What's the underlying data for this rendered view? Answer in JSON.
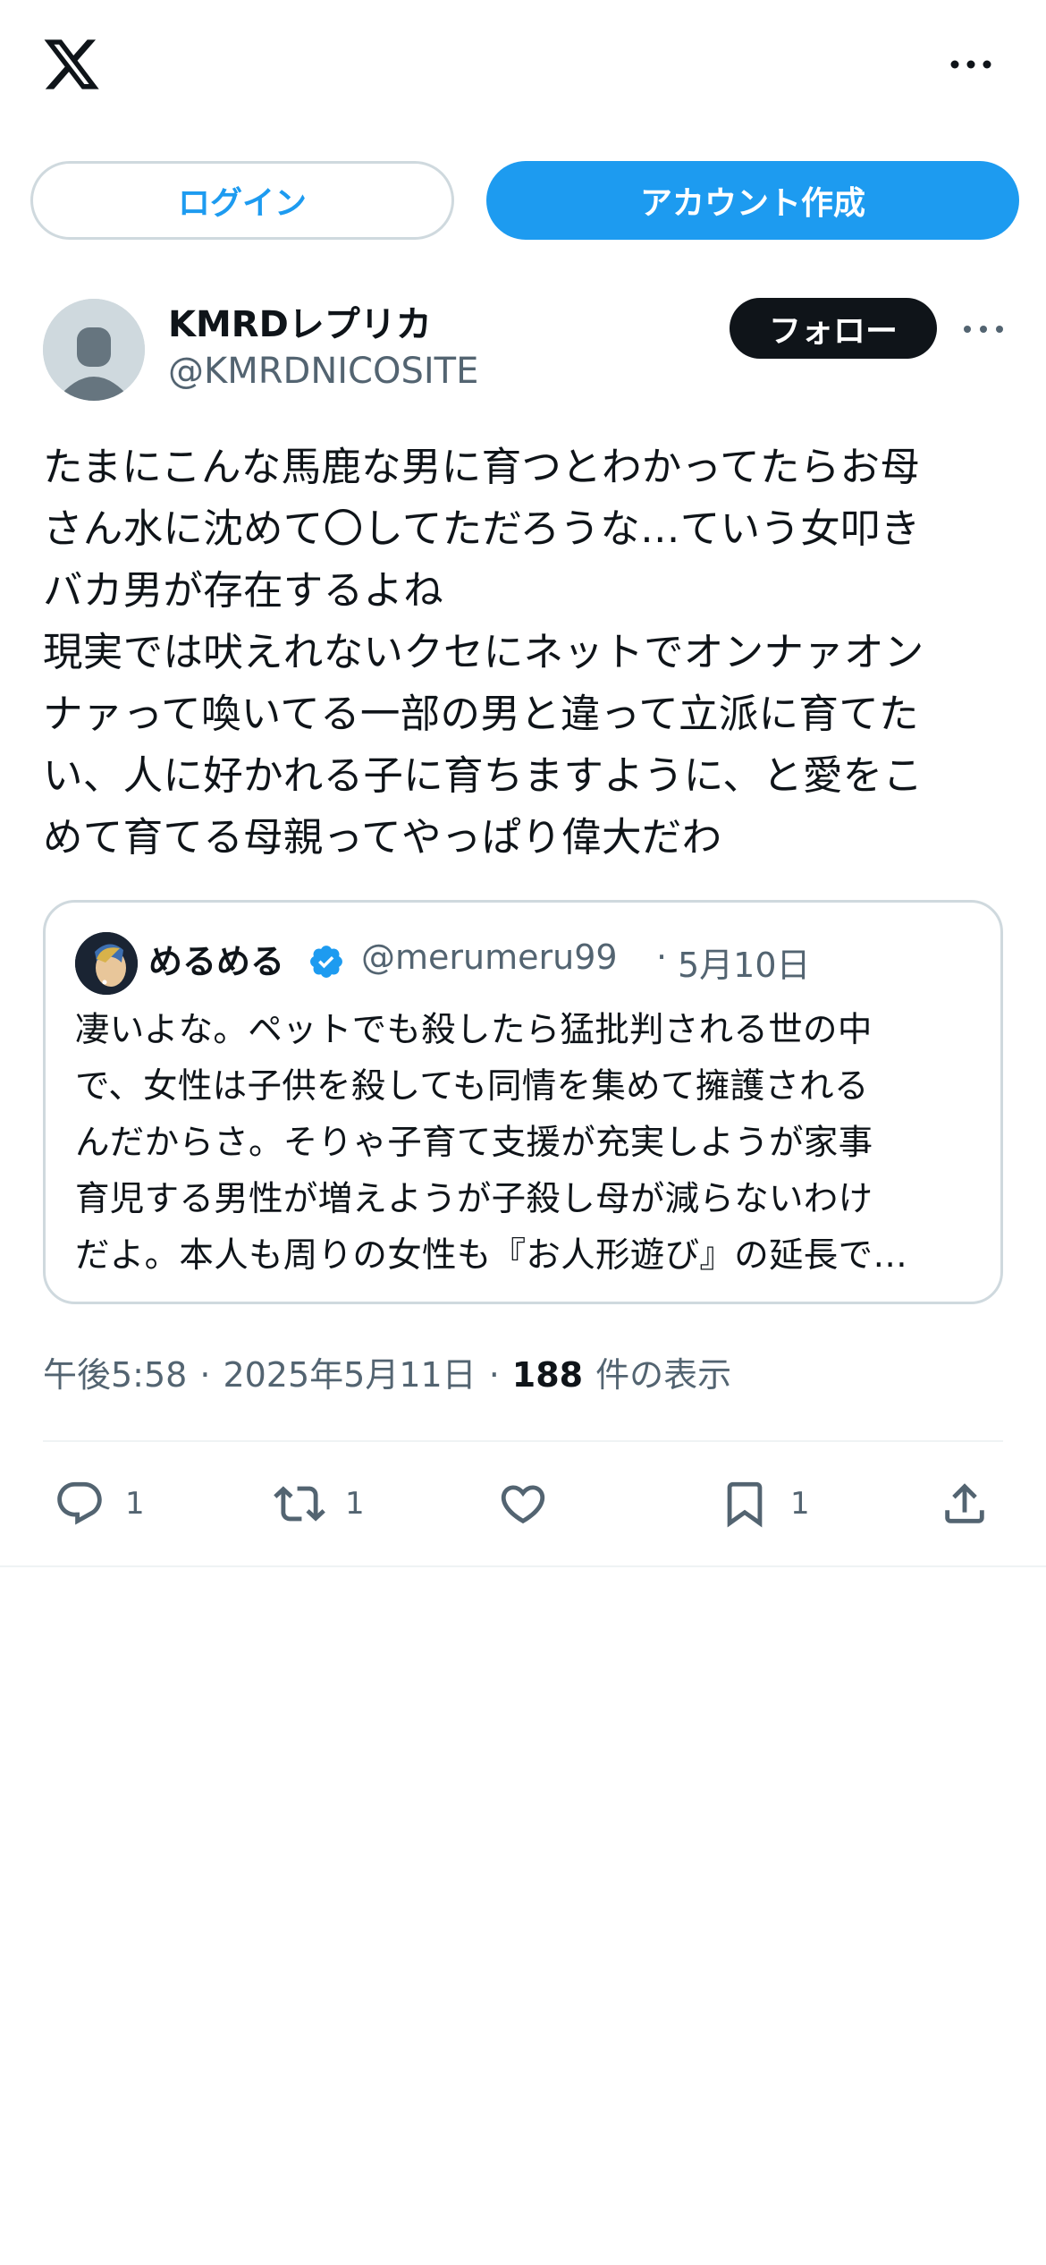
{
  "header": {
    "logo_icon": "x-logo-icon",
    "more_icon": "more-horizontal-icon"
  },
  "auth": {
    "login_label": "ログイン",
    "signup_label": "アカウント作成",
    "accent_color": "#1d9bf0"
  },
  "post": {
    "author_name": "KMRDレプリカ",
    "author_handle": "@KMRDNICOSITE",
    "follow_label": "フォロー",
    "body": "たまにこんな馬鹿な男に育つとわかってたらお母\nさん水に沈めて〇してただろうな…ていう女叩き\nバカ男が存在するよね\n現実では吠えれないクセにネットでオンナァオン\nナァって喚いてる一部の男と違って立派に育てた\nい、人に好かれる子に育ちますように、と愛をこ\nめて育てる母親ってやっぱり偉大だわ",
    "time": "午後5:58",
    "date": "2025年5月11日",
    "separator": "·",
    "views_count": "188",
    "views_label": "件の表示"
  },
  "quote": {
    "name": "めるめる",
    "verified_icon": "verified-badge-icon",
    "handle": "@merumeru99",
    "separator": "·",
    "date": "5月10日",
    "body": "凄いよな。ペットでも殺したら猛批判される世の中\nで、女性は子供を殺しても同情を集めて擁護される\nんだからさ。そりゃ子育て支援が充実しようが家事\n育児する男性が増えようが子殺し母が減らないわけ\nだよ。本人も周りの女性も『お人形遊び』の延長で…"
  },
  "actions": {
    "reply_count": "1",
    "repost_count": "1",
    "bookmark_count": "1"
  }
}
